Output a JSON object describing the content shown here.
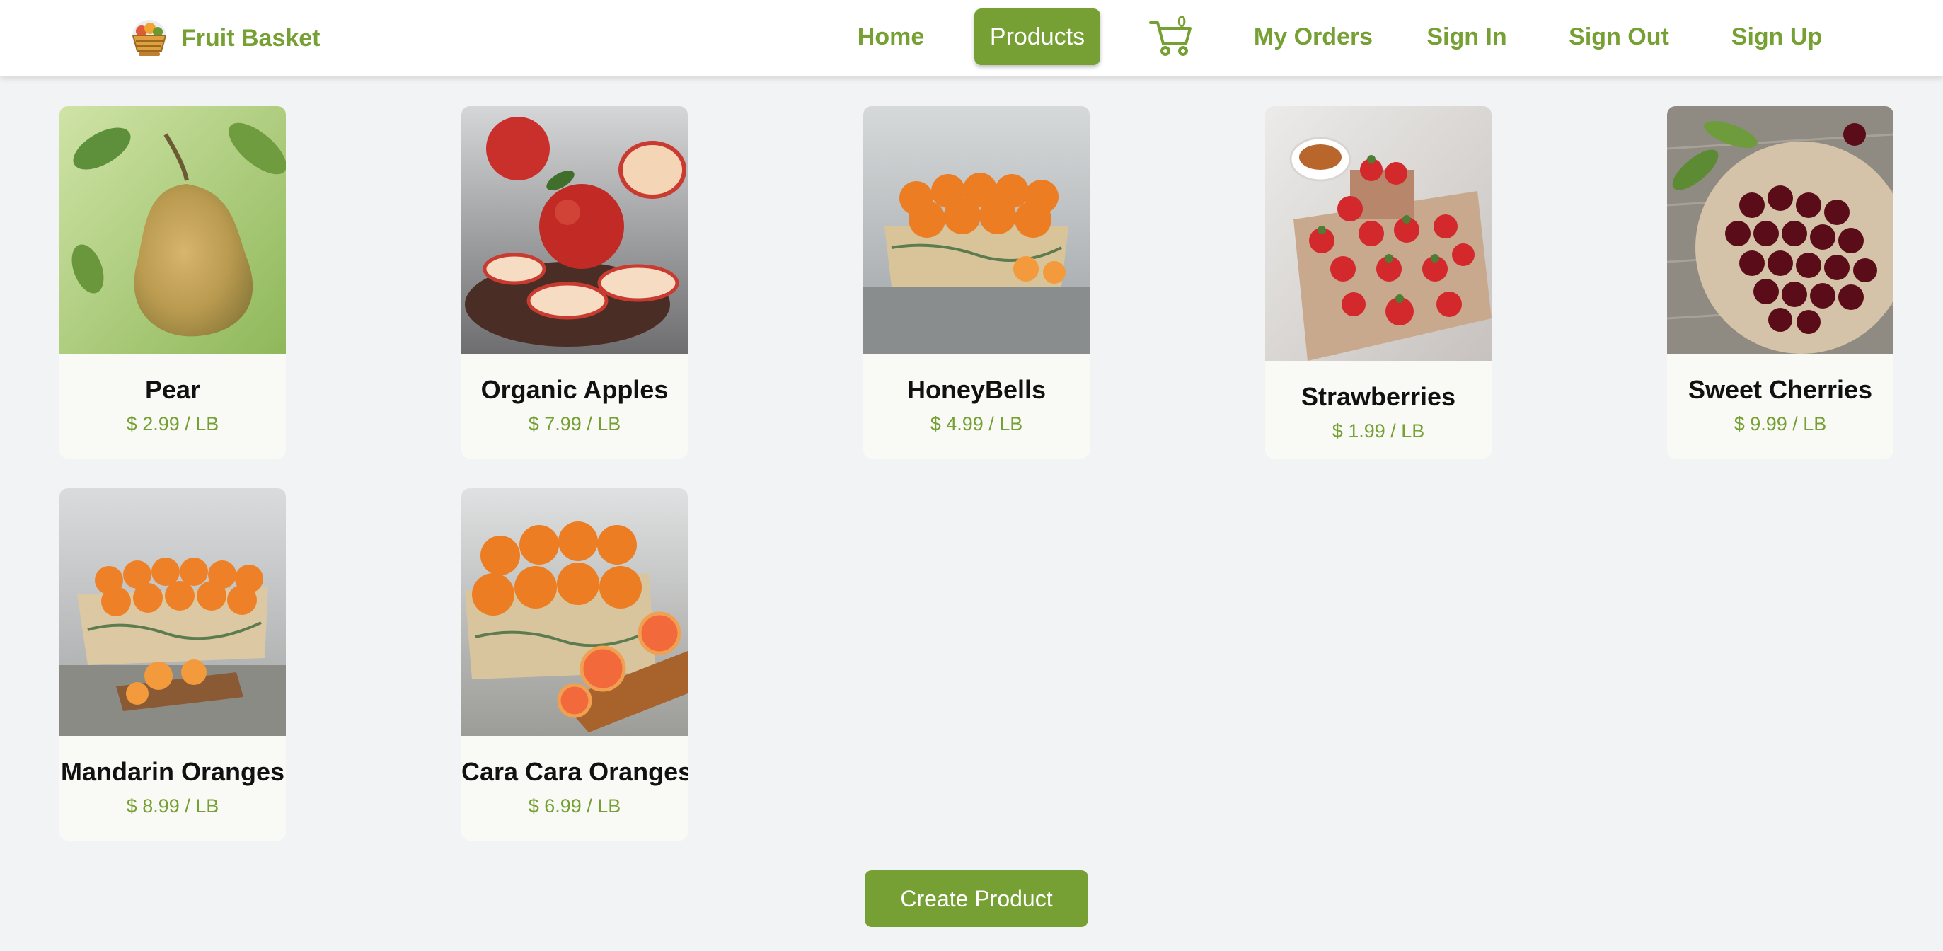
{
  "brand": {
    "name": "Fruit Basket",
    "logo_icon": "fruit-basket-logo-icon"
  },
  "nav": {
    "home": "Home",
    "products": "Products",
    "cart_count": "0",
    "my_orders": "My Orders",
    "sign_in": "Sign In",
    "sign_out": "Sign Out",
    "sign_up": "Sign Up"
  },
  "products": [
    {
      "name": "Pear",
      "price": "$ 2.99 / LB"
    },
    {
      "name": "Organic Apples",
      "price": "$ 7.99 / LB"
    },
    {
      "name": "HoneyBells",
      "price": "$ 4.99 / LB"
    },
    {
      "name": "Strawberries",
      "price": "$ 1.99 / LB"
    },
    {
      "name": "Sweet Cherries",
      "price": "$ 9.99 / LB"
    },
    {
      "name": "Mandarin Oranges",
      "price": "$ 8.99 / LB"
    },
    {
      "name": "Cara Cara Oranges",
      "price": "$ 6.99 / LB"
    }
  ],
  "actions": {
    "create_product": "Create Product"
  },
  "colors": {
    "accent": "#76a033",
    "page_background": "#f2f3f5",
    "card_background": "#f9faf6"
  }
}
